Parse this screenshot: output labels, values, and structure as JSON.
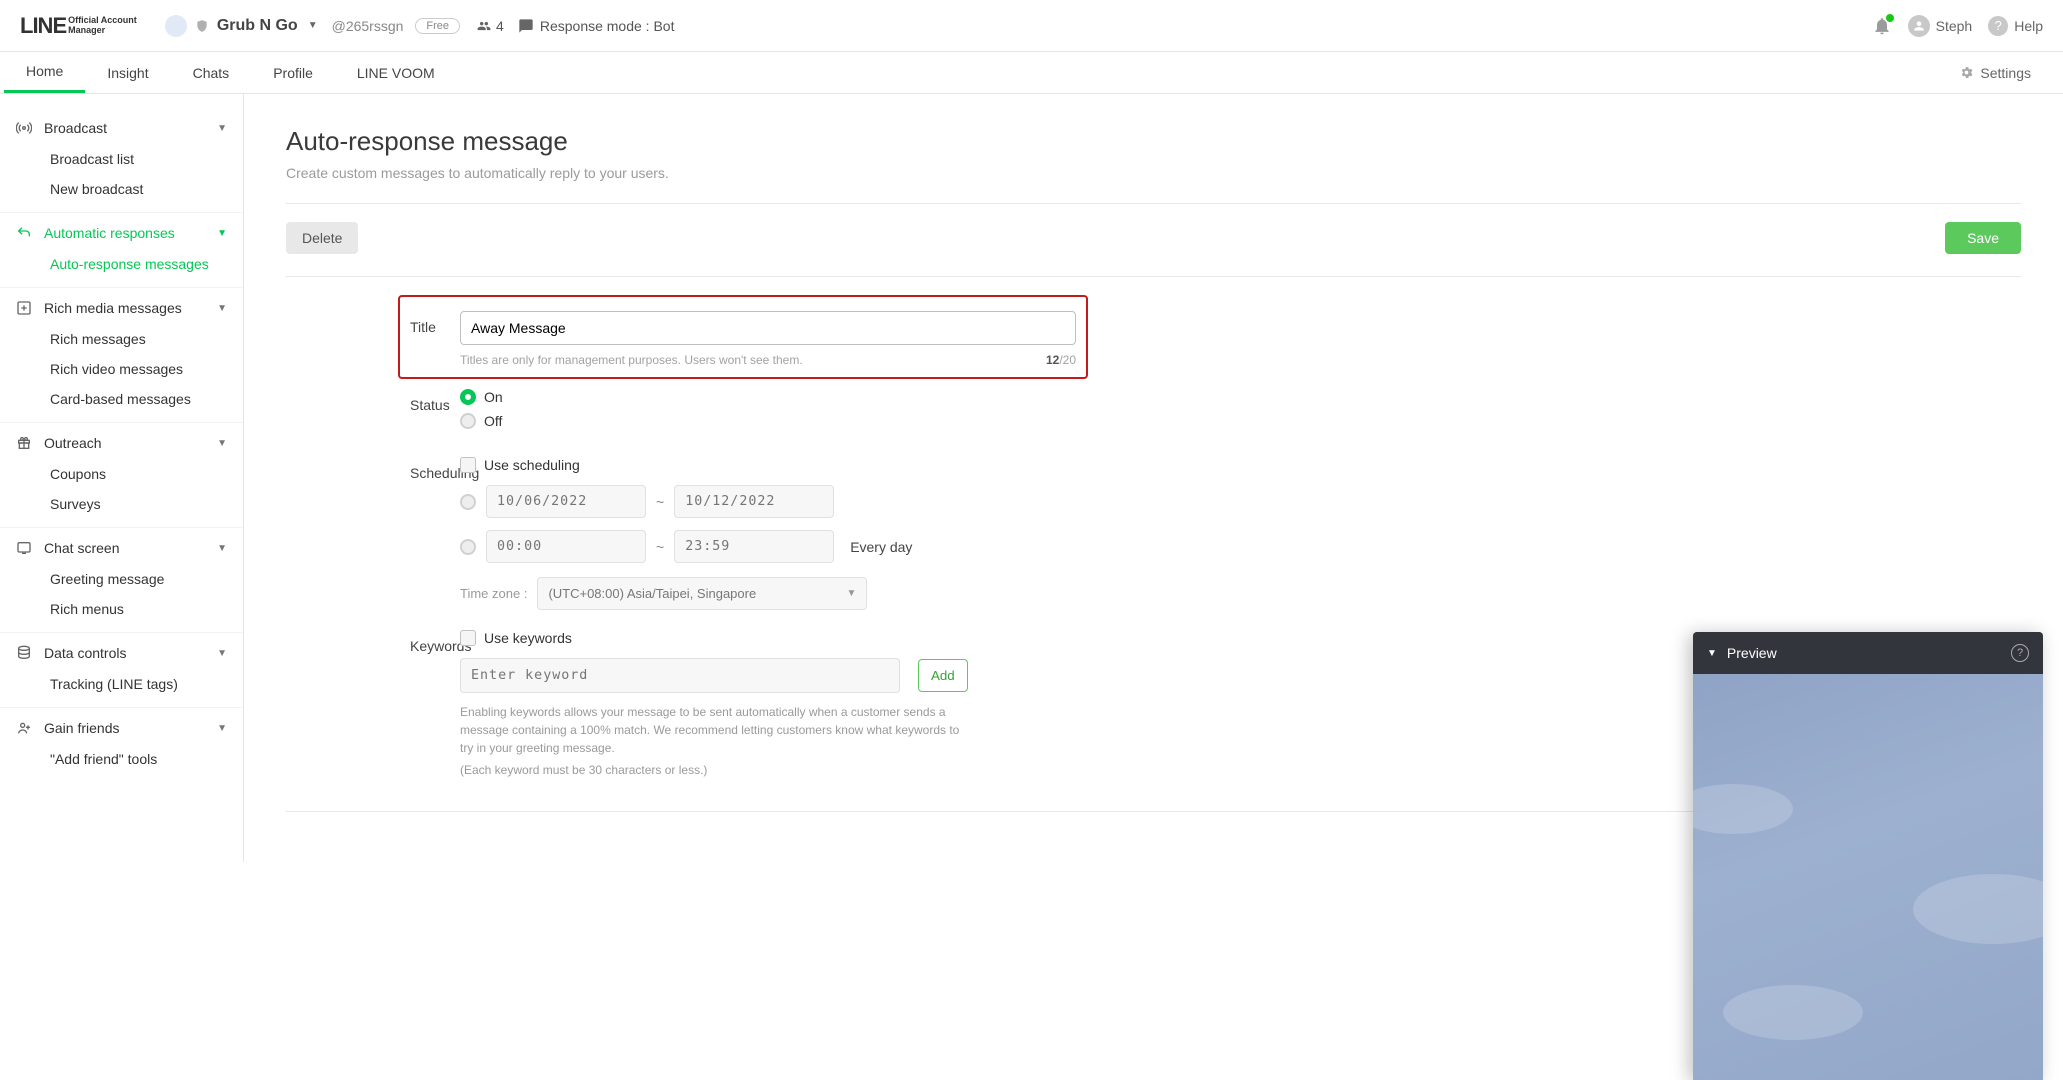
{
  "topbar": {
    "logo_main": "LINE",
    "logo_sub1": "Official Account",
    "logo_sub2": "Manager",
    "account_name": "Grub N Go",
    "account_handle": "@265rssgn",
    "plan_badge": "Free",
    "friend_count": "4",
    "response_mode_label": "Response mode : Bot",
    "username": "Steph",
    "help_label": "Help"
  },
  "nav": {
    "tabs": [
      "Home",
      "Insight",
      "Chats",
      "Profile",
      "LINE VOOM"
    ],
    "active_tab": "Home",
    "settings_label": "Settings"
  },
  "sidebar": {
    "broadcast": {
      "label": "Broadcast",
      "items": [
        "Broadcast list",
        "New broadcast"
      ]
    },
    "auto": {
      "label": "Automatic responses",
      "items": [
        "Auto-response messages"
      ]
    },
    "rich": {
      "label": "Rich media messages",
      "items": [
        "Rich messages",
        "Rich video messages",
        "Card-based messages"
      ]
    },
    "outreach": {
      "label": "Outreach",
      "items": [
        "Coupons",
        "Surveys"
      ]
    },
    "chat": {
      "label": "Chat screen",
      "items": [
        "Greeting message",
        "Rich menus"
      ]
    },
    "data": {
      "label": "Data controls",
      "items": [
        "Tracking (LINE tags)"
      ]
    },
    "gain": {
      "label": "Gain friends",
      "items": [
        "\"Add friend\" tools"
      ]
    }
  },
  "page": {
    "title": "Auto-response message",
    "desc": "Create custom messages to automatically reply to your users.",
    "delete": "Delete",
    "save": "Save"
  },
  "form": {
    "title_label": "Title",
    "title_value": "Away Message",
    "title_help": "Titles are only for management purposes. Users won't see them.",
    "title_count": "12",
    "title_max": "/20",
    "status_label": "Status",
    "status_on": "On",
    "status_off": "Off",
    "sched_label": "Scheduling",
    "sched_check": "Use scheduling",
    "date_from": "10/06/2022",
    "date_to": "10/12/2022",
    "time_from": "00:00",
    "time_to": "23:59",
    "everyday": "Every day",
    "tz_label": "Time zone :",
    "tz_value": "(UTC+08:00) Asia/Taipei, Singapore",
    "kw_label": "Keywords",
    "kw_check": "Use keywords",
    "kw_placeholder": "Enter keyword",
    "kw_add": "Add",
    "kw_help1": "Enabling keywords allows your message to be sent automatically when a customer sends a message containing a 100% match. We recommend letting customers know what keywords to try in your greeting message.",
    "kw_help2": "(Each keyword must be 30 characters or less.)"
  },
  "preview": {
    "label": "Preview"
  }
}
